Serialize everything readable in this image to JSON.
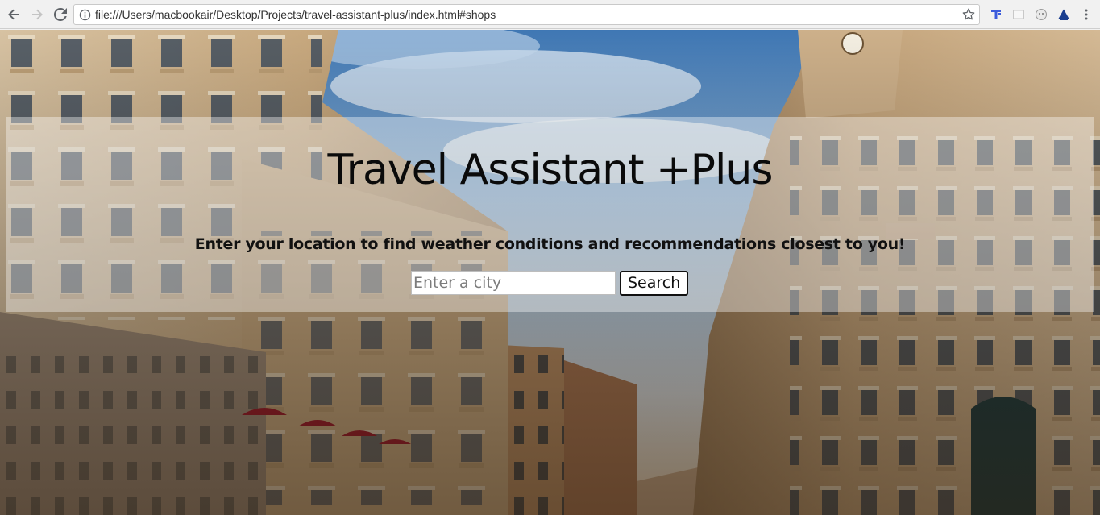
{
  "browser": {
    "url": "file:///Users/macbookair/Desktop/Projects/travel-assistant-plus/index.html#shops",
    "icons": {
      "back": "arrow-left-icon",
      "forward": "arrow-right-icon",
      "reload": "reload-icon",
      "info": "info-icon",
      "bookmark": "star-icon",
      "extensions": [
        "t-extension-icon",
        "window-extension-icon",
        "ghost-extension-icon",
        "triangle-extension-icon"
      ],
      "menu": "more-vertical-icon"
    }
  },
  "hero": {
    "title": "Travel Assistant +Plus",
    "subtitle": "Enter your location to find weather conditions and recommendations closest to you!",
    "search": {
      "placeholder": "Enter a city",
      "value": "",
      "button_label": "Search"
    }
  },
  "colors": {
    "chrome": "#f1f1f1",
    "banner_overlay": "rgba(255,255,255,0.38)",
    "title_text": "#0a0a0a",
    "sky": "#6fa3d2"
  }
}
